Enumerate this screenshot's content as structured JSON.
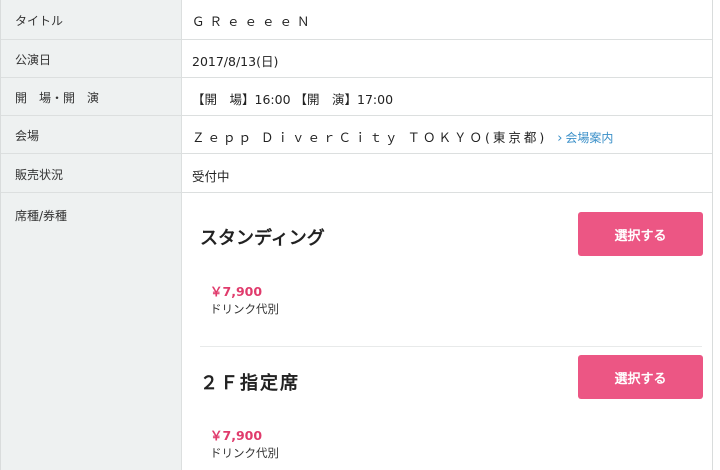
{
  "rows": [
    {
      "label": "タイトル",
      "value": "ＧＲｅｅｅｅＮ"
    },
    {
      "label": "公演日",
      "value": "2017/8/13(日)"
    },
    {
      "label": "開　場・開　演",
      "value": "【開　場】16:00 【開　演】17:00"
    },
    {
      "label": "会場",
      "value": "Ｚｅｐｐ ＤｉｖｅｒＣｉｔｙ ＴＯＫＹＯ(東京都)",
      "link": "会場案内"
    },
    {
      "label": "販売状況",
      "value": "受付中"
    },
    {
      "label": "席種/券種"
    }
  ],
  "tickets": [
    {
      "name": "スタンディング",
      "button": "選択する",
      "price": "￥7,900",
      "note": "ドリンク代別"
    },
    {
      "name": "２Ｆ指定席",
      "button": "選択する",
      "price": "￥7,900",
      "note": "ドリンク代別"
    }
  ],
  "colors": {
    "accent": "#ec5684",
    "price": "#e03b6c",
    "link": "#3a8fc8",
    "label_bg": "#eef1f1"
  }
}
